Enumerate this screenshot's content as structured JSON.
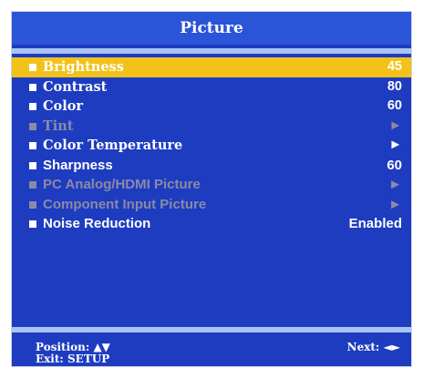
{
  "window": {
    "title": "Picture"
  },
  "menu": {
    "items": [
      {
        "label": "Brightness",
        "value": "45",
        "selected": true,
        "enabled": true,
        "font": "serif"
      },
      {
        "label": "Contrast",
        "value": "80",
        "selected": false,
        "enabled": true,
        "font": "serif"
      },
      {
        "label": "Color",
        "value": "60",
        "selected": false,
        "enabled": true,
        "font": "serif"
      },
      {
        "label": "Tint",
        "value": "►",
        "selected": false,
        "enabled": false,
        "font": "serif"
      },
      {
        "label": "Color Temperature",
        "value": "►",
        "selected": false,
        "enabled": true,
        "font": "serif"
      },
      {
        "label": "Sharpness",
        "value": "60",
        "selected": false,
        "enabled": true,
        "font": "sans"
      },
      {
        "label": "PC Analog/HDMI Picture",
        "value": "►",
        "selected": false,
        "enabled": false,
        "font": "sans"
      },
      {
        "label": "Component Input Picture",
        "value": "►",
        "selected": false,
        "enabled": false,
        "font": "sans"
      },
      {
        "label": "Noise Reduction",
        "value": "Enabled",
        "selected": false,
        "enabled": true,
        "font": "sans"
      }
    ]
  },
  "footer": {
    "position": "Position: ▲▼",
    "exit": "Exit: SETUP",
    "next": "Next: ◄►"
  },
  "colors": {
    "panel": "#1e3cc0",
    "title_bar": "#2a55d8",
    "separator": "#a9c4f2",
    "highlight": "#f2c21a",
    "disabled": "#8a8aa6"
  }
}
